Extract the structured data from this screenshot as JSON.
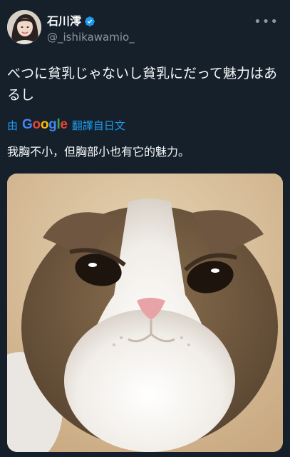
{
  "author": {
    "display_name": "石川澪",
    "handle": "@_ishikawamio_",
    "verified": true
  },
  "tweet": {
    "text": "べつに貧乳じゃないし貧乳にだって魅力はあるし"
  },
  "translation": {
    "by": "由",
    "provider": "Google",
    "action": "翻譯自日文",
    "text": "我胸不小，但胸部小也有它的魅力。"
  },
  "media": {
    "description": "cat-photo"
  },
  "colors": {
    "background": "#15202b",
    "text": "#f7f9f9",
    "secondary": "#8b98a5",
    "accent": "#1d9bf0"
  }
}
